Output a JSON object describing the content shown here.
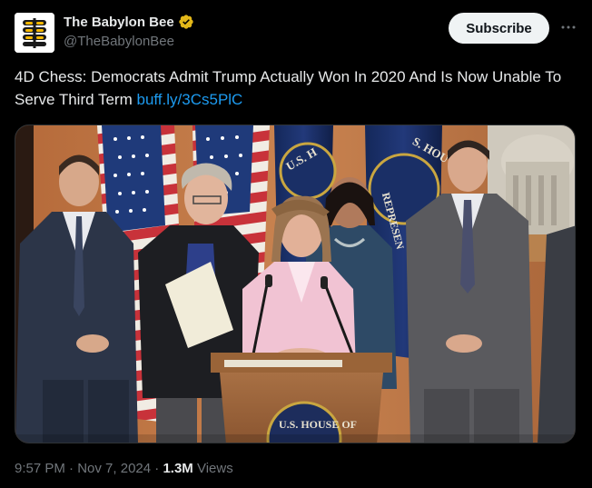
{
  "account": {
    "display_name": "The Babylon Bee",
    "handle": "@TheBabylonBee",
    "verified": true,
    "avatar_icon": "babylon-bee-logo"
  },
  "actions": {
    "subscribe_label": "Subscribe",
    "more_icon": "more-horizontal-icon"
  },
  "tweet": {
    "text": "4D Chess: Democrats Admit Trump Actually Won In 2020 And Is Now Unable To Serve Third Term ",
    "link": "buff.ly/3Cs5PlC"
  },
  "media": {
    "description": "press-conference-photo",
    "podium_seal_text": "U.S. HOUSE OF",
    "flag_seal_text_left": "U.S. H",
    "flag_seal_text_right": "REPRESEN",
    "flag_seal_text_top": "S. HOU"
  },
  "meta": {
    "time": "9:57 PM",
    "separator": "·",
    "date": "Nov 7, 2024",
    "views_count": "1.3M",
    "views_label": "Views"
  },
  "colors": {
    "background": "#000000",
    "text": "#e7e9ea",
    "secondary": "#71767b",
    "link": "#1d9bf0",
    "verified_badge": "#e2b719"
  }
}
